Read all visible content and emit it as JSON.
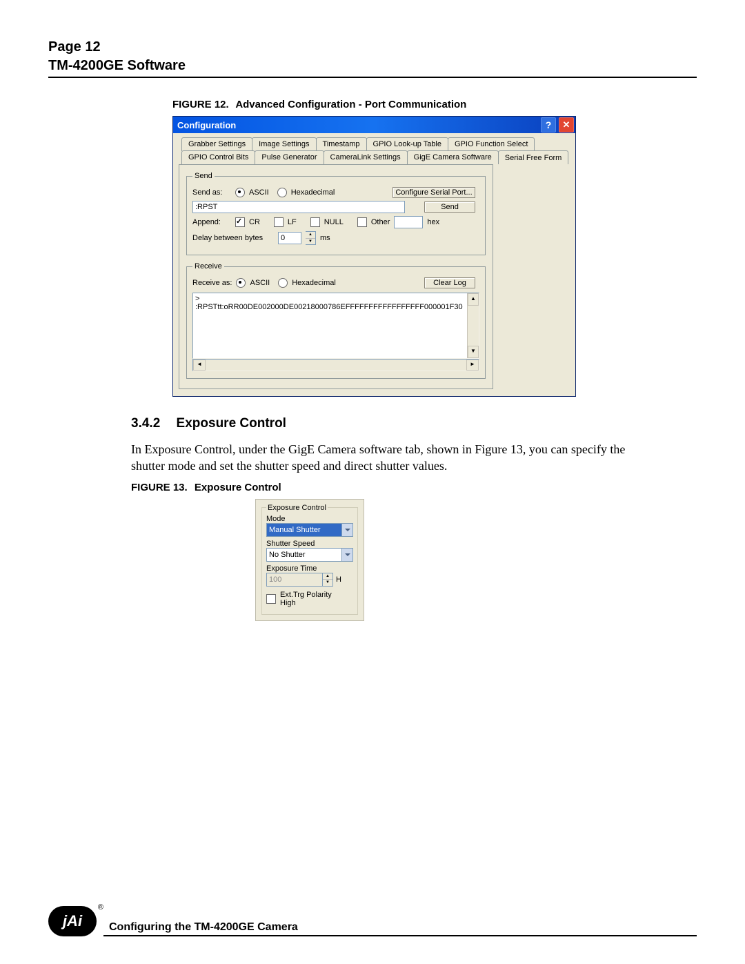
{
  "page": {
    "page_label": "Page 12",
    "doc_title": "TM-4200GE Software"
  },
  "figure12": {
    "caption_prefix": "FIGURE 12.",
    "caption": "Advanced Configuration - Port Communication"
  },
  "dialog": {
    "title": "Configuration",
    "tabs_row1": [
      "Grabber Settings",
      "Image Settings",
      "Timestamp",
      "GPIO Look-up Table",
      "GPIO Function Select"
    ],
    "tabs_row2": [
      "GPIO Control Bits",
      "Pulse Generator",
      "CameraLink Settings",
      "GigE Camera Software",
      "Serial Free Form"
    ],
    "active_tab": "Serial Free Form",
    "send": {
      "group_label": "Send",
      "send_as_label": "Send as:",
      "ascii": "ASCII",
      "hex": "Hexadecimal",
      "configure_btn": "Configure Serial Port...",
      "command_value": ":RPST",
      "send_btn": "Send",
      "append_label": "Append:",
      "cr": "CR",
      "lf": "LF",
      "null": "NULL",
      "other": "Other",
      "other_value": "",
      "other_suffix": "hex",
      "delay_label": "Delay between bytes",
      "delay_value": "0",
      "delay_unit": "ms"
    },
    "receive": {
      "group_label": "Receive",
      "receive_as_label": "Receive as:",
      "ascii": "ASCII",
      "hex": "Hexadecimal",
      "clear_btn": "Clear Log",
      "log_text": "> :RPSTtt:oRR00DE002000DE00218000786EFFFFFFFFFFFFFFFFF000001F30"
    }
  },
  "section": {
    "number": "3.4.2",
    "title": "Exposure Control",
    "paragraph": "In Exposure Control, under the GigE Camera software tab, shown in Figure 13, you can specify the shutter mode and set the shutter speed and direct shutter values."
  },
  "figure13": {
    "caption_prefix": "FIGURE 13.",
    "caption": "Exposure Control"
  },
  "exposure_panel": {
    "group_label": "Exposure Control",
    "mode_label": "Mode",
    "mode_value": "Manual Shutter",
    "speed_label": "Shutter Speed",
    "speed_value": "No Shutter",
    "time_label": "Exposure Time",
    "time_value": "100",
    "time_unit": "H",
    "polarity_label": "Ext.Trg Polarity High"
  },
  "footer": {
    "text": "Configuring the TM-4200GE Camera",
    "logo_text": "jAi",
    "registered": "®"
  }
}
